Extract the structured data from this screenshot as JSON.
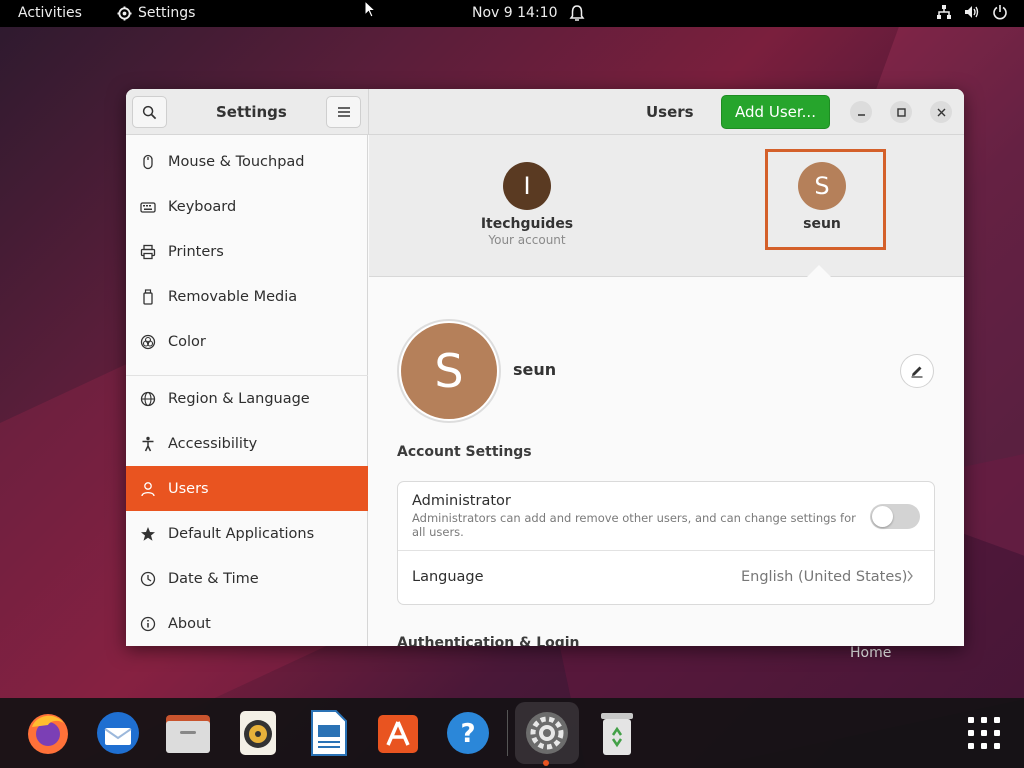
{
  "topbar": {
    "activities": "Activities",
    "app_name": "Settings",
    "clock": "Nov 9  14:10"
  },
  "window": {
    "sidebar_title": "Settings",
    "page_title": "Users",
    "add_user_label": "Add User...",
    "sidebar_items": [
      {
        "label": "Mouse & Touchpad",
        "icon": "mouse-icon"
      },
      {
        "label": "Keyboard",
        "icon": "keyboard-icon"
      },
      {
        "label": "Printers",
        "icon": "printer-icon"
      },
      {
        "label": "Removable Media",
        "icon": "removable-media-icon"
      },
      {
        "label": "Color",
        "icon": "color-icon"
      },
      {
        "label": "Region & Language",
        "icon": "globe-icon"
      },
      {
        "label": "Accessibility",
        "icon": "accessibility-icon"
      },
      {
        "label": "Users",
        "icon": "user-icon",
        "active": true
      },
      {
        "label": "Default Applications",
        "icon": "star-icon"
      },
      {
        "label": "Date & Time",
        "icon": "clock-icon"
      },
      {
        "label": "About",
        "icon": "info-icon"
      }
    ]
  },
  "users": {
    "accounts": [
      {
        "initial": "I",
        "name": "Itechguides",
        "subtitle": "Your account",
        "color": "#5a3a22"
      },
      {
        "initial": "S",
        "name": "seun",
        "color": "#b5805a",
        "selected": true
      }
    ],
    "selected_initial": "S",
    "selected_name": "seun",
    "account_settings_title": "Account Settings",
    "administrator_label": "Administrator",
    "administrator_desc": "Administrators can add and remove other users, and can change settings for all users.",
    "administrator_enabled": false,
    "language_label": "Language",
    "language_value": "English (United States)",
    "auth_section_title": "Authentication & Login"
  },
  "desktop": {
    "home_label": "Home"
  },
  "dock": {
    "apps": [
      "firefox-icon",
      "thunderbird-icon",
      "files-icon",
      "rhythmbox-icon",
      "writer-icon",
      "app-center-icon",
      "help-icon",
      "settings-icon",
      "trash-icon",
      "show-apps-icon"
    ],
    "active_app": "settings-icon"
  },
  "colors": {
    "accent": "#e95420",
    "add_user_green": "#26a52c",
    "highlight_box": "#d4602a"
  }
}
